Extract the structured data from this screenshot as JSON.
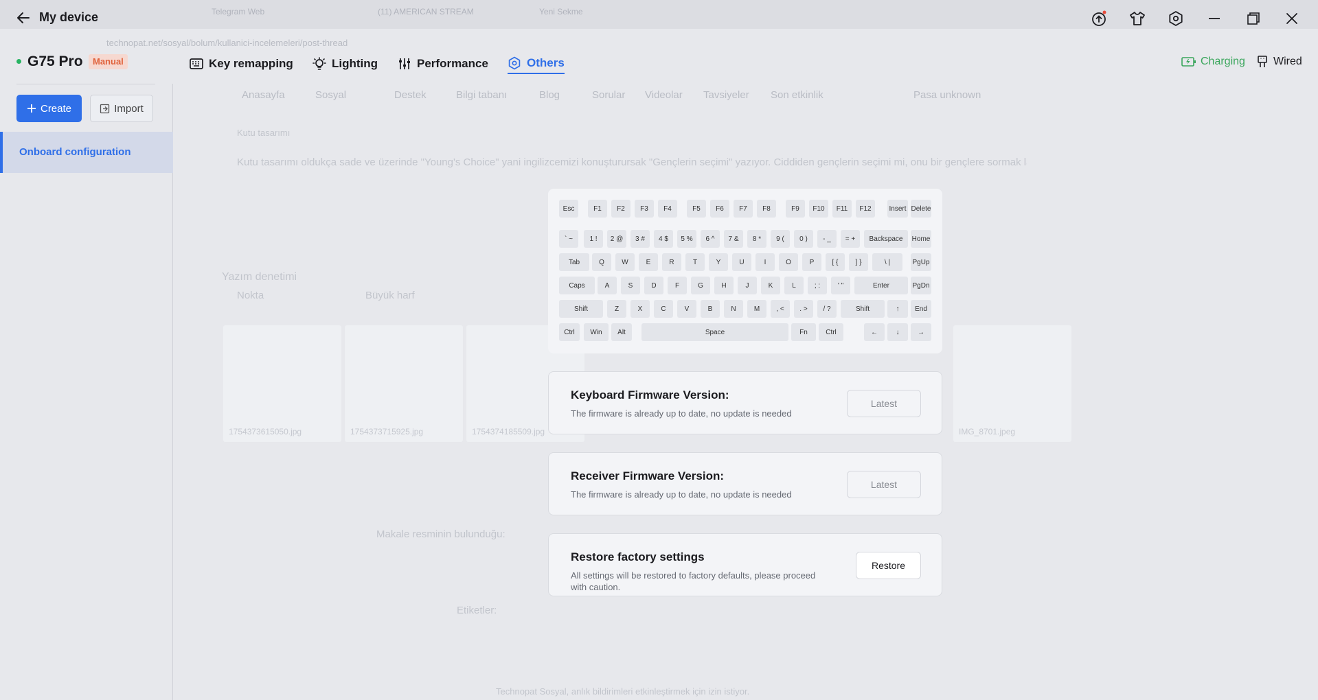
{
  "window": {
    "title": "My device"
  },
  "device": {
    "name": "G75 Pro",
    "mode_badge": "Manual",
    "status_color": "#28b463"
  },
  "tabs": [
    {
      "label": "Key remapping",
      "icon": "keyboard-icon"
    },
    {
      "label": "Lighting",
      "icon": "bulb-icon"
    },
    {
      "label": "Performance",
      "icon": "sliders-icon"
    },
    {
      "label": "Others",
      "icon": "hexagon-gear-icon",
      "active": true
    }
  ],
  "connection": {
    "charging_label": "Charging",
    "wired_label": "Wired",
    "charging_color": "#3aa65c"
  },
  "sidebar": {
    "create_label": "Create",
    "import_label": "Import",
    "items": [
      {
        "label": "Onboard configuration",
        "active": true
      }
    ]
  },
  "keyboard": {
    "rows": [
      [
        "Esc",
        "F1",
        "F2",
        "F3",
        "F4",
        "F5",
        "F6",
        "F7",
        "F8",
        "F9",
        "F10",
        "F11",
        "F12",
        "Insert",
        "Delete"
      ],
      [
        "` ~",
        "1 !",
        "2 @",
        "3 #",
        "4 $",
        "5 %",
        "6 ^",
        "7 &",
        "8 *",
        "9 (",
        "0 )",
        "- _",
        "= +",
        "Backspace",
        "Home"
      ],
      [
        "Tab",
        "Q",
        "W",
        "E",
        "R",
        "T",
        "Y",
        "U",
        "I",
        "O",
        "P",
        "[ {",
        "] }",
        "\\ |",
        "PgUp"
      ],
      [
        "Caps",
        "A",
        "S",
        "D",
        "F",
        "G",
        "H",
        "J",
        "K",
        "L",
        "; :",
        "' \"",
        "Enter",
        "PgDn"
      ],
      [
        "Shift",
        "Z",
        "X",
        "C",
        "V",
        "B",
        "N",
        "M",
        ", <",
        ". >",
        "/ ?",
        "Shift",
        "↑",
        "End"
      ],
      [
        "Ctrl",
        "Win",
        "Alt",
        "Space",
        "Fn",
        "Ctrl",
        "←",
        "↓",
        "→"
      ]
    ]
  },
  "keyboard_firmware": {
    "title": "Keyboard Firmware Version:",
    "description": "The firmware is already up to date, no update is needed",
    "button": "Latest"
  },
  "receiver_firmware": {
    "title": "Receiver Firmware Version:",
    "description": "The firmware is already up to date, no update is needed",
    "button": "Latest"
  },
  "factory_reset": {
    "title": "Restore factory settings",
    "description": "All settings will be restored to factory defaults, please proceed with caution.",
    "button": "Restore"
  },
  "background_page": {
    "tabs": [
      "Telegram Web",
      "(11) AMERICAN STREAM",
      "Yeni Sekme"
    ],
    "address": "technopat.net/sosyal/bolum/kullanici-incelemeleri/post-thread",
    "nav": [
      "Anasayfa",
      "Sosyal",
      "Destek",
      "Bilgi tabanı",
      "Blog",
      "Sorular",
      "Videolar",
      "Tavsiyeler",
      "Son etkinlik",
      "Pasa unknown"
    ],
    "text_lines": [
      "Kutu tasarımı",
      "Kutu tasarımı oldukça sade ve üzerinde \"Young's Choice\" yani ingilizcemizi konuşturursak \"Gençlerin seçimi\" yazıyor. Ciddiden gençlerin seçimi mi, onu bir gençlere sormak lazım",
      "Yazım denetimi",
      "Nokta",
      "Büyük harf",
      "Makale resminin bulunduğu:",
      "Etiketler:",
      "Technopat Sosyal, anlık bildirimleri etkinleştirmek için izin istiyor."
    ],
    "thumb_captions": [
      "1754373615050.jpg",
      "1754373715925.jpg",
      "1754374185509.jpg",
      "IMG_8701.jpeg"
    ]
  }
}
